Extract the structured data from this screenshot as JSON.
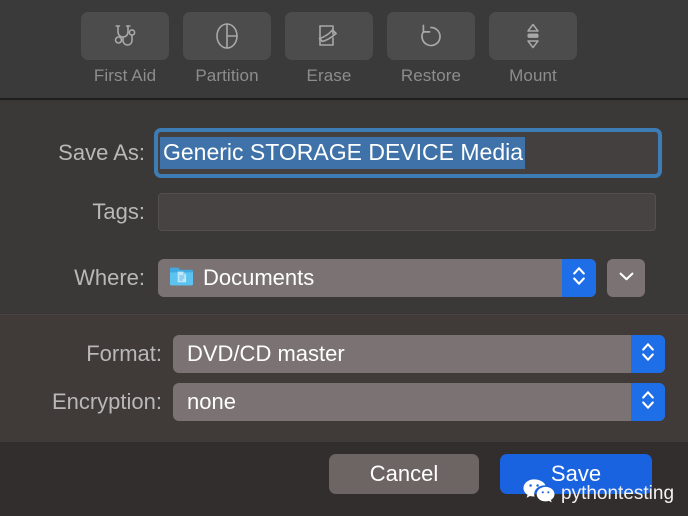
{
  "toolbar": {
    "items": [
      {
        "label": "First Aid",
        "icon": "stethoscope-icon",
        "enabled": false
      },
      {
        "label": "Partition",
        "icon": "partition-pie-icon",
        "enabled": false
      },
      {
        "label": "Erase",
        "icon": "eraser-icon",
        "enabled": false
      },
      {
        "label": "Restore",
        "icon": "restore-arrow-icon",
        "enabled": false
      },
      {
        "label": "Mount",
        "icon": "mount-arrows-icon",
        "enabled": false
      }
    ]
  },
  "dialog": {
    "save_as": {
      "label": "Save As:",
      "value": "Generic STORAGE DEVICE Media",
      "placeholder": "",
      "selected": true,
      "focused": true
    },
    "tags": {
      "label": "Tags:",
      "value": "",
      "placeholder": ""
    },
    "where": {
      "label": "Where:",
      "value": "Documents",
      "icon": "documents-folder-icon",
      "expand_icon": "chevron-down-icon",
      "stepper_icon": "stepper-up-down-icon"
    },
    "format": {
      "label": "Format:",
      "value": "DVD/CD master",
      "stepper_icon": "stepper-up-down-icon"
    },
    "encryption": {
      "label": "Encryption:",
      "value": "none",
      "stepper_icon": "stepper-up-down-icon"
    },
    "buttons": {
      "cancel": "Cancel",
      "save": "Save"
    }
  },
  "watermark": {
    "text": "pythontesting",
    "icon": "wechat-icon"
  },
  "colors": {
    "toolbar_bg": "#3a3a3a",
    "sheet_upper_bg": "#3b3838",
    "sheet_lower_bg": "#403a39",
    "footer_bg": "#332e2e",
    "accent_blue": "#1a63e0",
    "focus_ring": "#3d7cb4",
    "selection_blue": "#3f72a8",
    "stepper_blue": "#1e6ee8",
    "popup_bg": "#7b7373",
    "cancel_bg": "#6d6563",
    "label_text": "#b9b7b7",
    "disabled_label": "#8e8d8d",
    "value_text": "#ffffff"
  }
}
